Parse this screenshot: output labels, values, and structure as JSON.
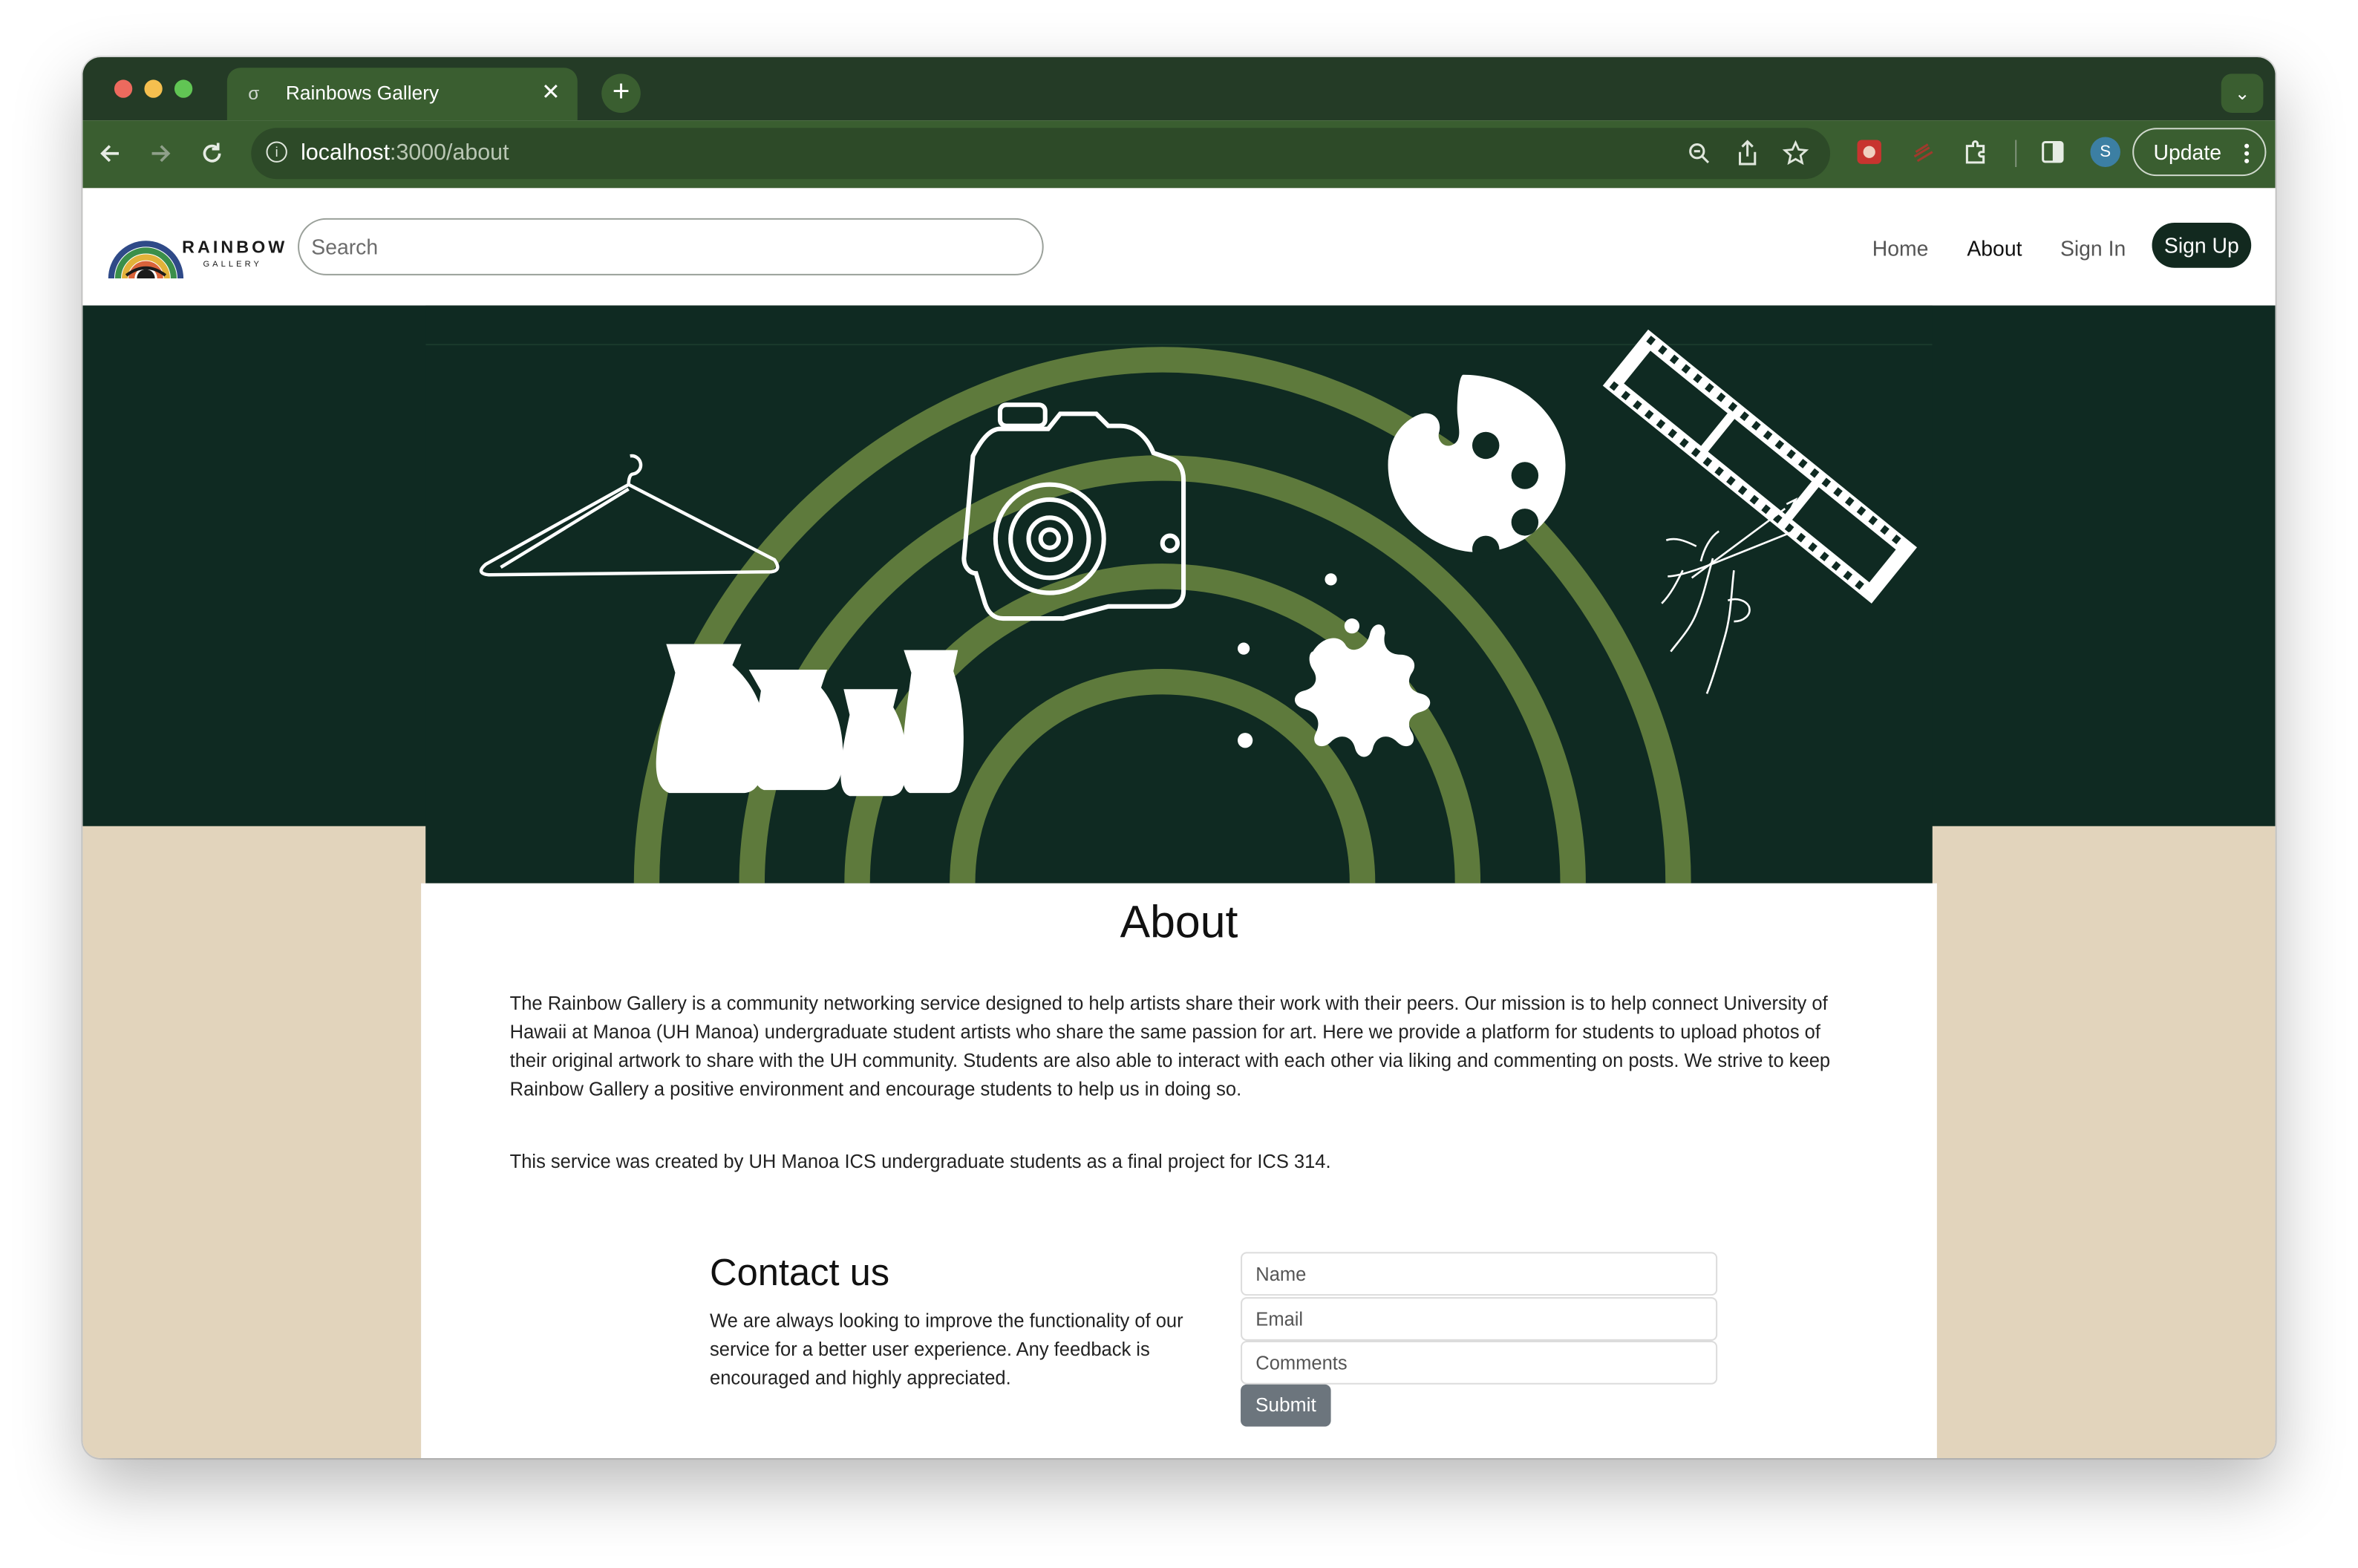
{
  "browser": {
    "tab_title": "Rainbows Gallery",
    "tab_favicon": "σ",
    "tab_close": "✕",
    "new_tab": "+",
    "tab_menu": "⌄",
    "url_host": "localhost",
    "url_path": ":3000/about",
    "avatar_letter": "S",
    "update_label": "Update",
    "icons": [
      "back-icon",
      "forward-icon",
      "reload-icon",
      "zoom-icon",
      "share-icon",
      "bookmark-star-icon",
      "extension-icon",
      "puzzle-icon",
      "sidebar-icon",
      "kebab-icon"
    ]
  },
  "navbar": {
    "logo_text": "RAINBOW",
    "logo_sub": "GALLERY",
    "search_placeholder": "Search",
    "links": [
      "Home",
      "About",
      "Sign In"
    ],
    "signup_label": "Sign Up"
  },
  "about": {
    "title": "About",
    "paragraph1": "The Rainbow Gallery is a community networking service designed to help artists share their work with their peers. Our mission is to help connect University of Hawaii at Manoa (UH Manoa) undergraduate student artists who share the same passion for art. Here we provide a platform for students to upload photos of their original artwork to share with the UH community. Students are also able to interact with each other via liking and commenting on posts. We strive to keep Rainbow Gallery a positive environment and encourage students to help us in doing so.",
    "paragraph2": "This service was created by UH Manoa ICS undergraduate students as a final project for ICS 314."
  },
  "contact": {
    "title": "Contact us",
    "text": "We are always looking to improve the functionality of our service for a better user experience. Any feedback is encouraged and highly appreciated.",
    "name_placeholder": "Name",
    "email_placeholder": "Email",
    "comments_placeholder": "Comments",
    "submit_label": "Submit"
  },
  "colors": {
    "browser_frame": "#243b26",
    "browser_toolbar": "#3a5e30",
    "hero_bg": "#0f2a22",
    "hero_arc": "#5e7a3c",
    "page_bg": "#e2d4bc",
    "signup_bg": "#12291f",
    "submit_bg": "#6c757d"
  }
}
